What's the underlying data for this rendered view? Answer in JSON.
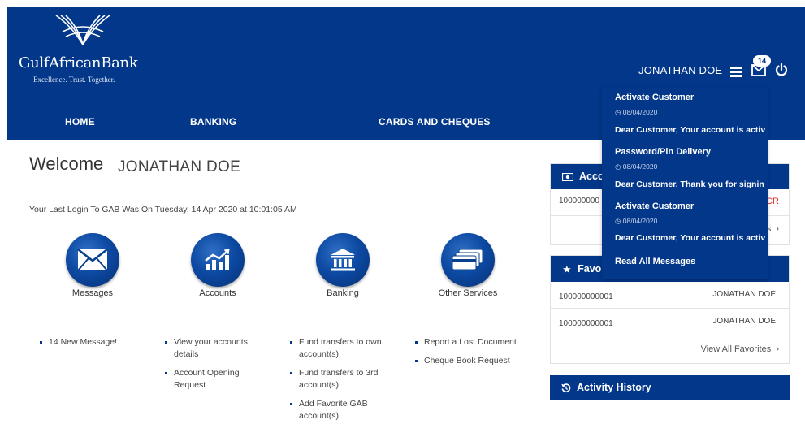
{
  "brand": {
    "name": "GulfAfricanBank",
    "tagline": "Excellence. Trust. Together."
  },
  "header": {
    "user_name": "JONATHAN DOE",
    "notification_count": "14"
  },
  "nav": [
    {
      "label": "HOME"
    },
    {
      "label": "BANKING"
    },
    {
      "label": "CARDS AND CHEQUES"
    }
  ],
  "welcome": {
    "greeting": "Welcome",
    "name": "JONATHAN DOE",
    "last_login": "Your Last Login To GAB Was On Tuesday, 14 Apr 2020 at 10:01:05 AM"
  },
  "services": [
    {
      "label": "Messages",
      "icon": "envelope-icon"
    },
    {
      "label": "Accounts",
      "icon": "chart-icon"
    },
    {
      "label": "Banking",
      "icon": "bank-icon"
    },
    {
      "label": "Other Services",
      "icon": "cards-icon"
    }
  ],
  "service_links": {
    "messages": [
      "14 New Message!"
    ],
    "accounts": [
      "View your accounts details",
      "Account Opening Request"
    ],
    "banking": [
      "Fund transfers to own account(s)",
      "Fund transfers to 3rd account(s)",
      "Add Favorite GAB account(s)"
    ],
    "other": [
      "Report a Lost Document",
      "Cheque Book Request"
    ]
  },
  "accounts_card": {
    "title": "Accou",
    "row_account": "100000000",
    "row_suffix": "CR",
    "view_all_fragment": "s"
  },
  "favorites_card": {
    "title": "Favori",
    "rows": [
      {
        "account": "100000000001",
        "name": "JONATHAN DOE"
      },
      {
        "account": "100000000001",
        "name": "JONATHAN DOE"
      }
    ],
    "view_all": "View All Favorites"
  },
  "activity_card": {
    "title": "Activity History"
  },
  "notifications": {
    "items": [
      {
        "title": "Activate Customer",
        "date": "08/04/2020",
        "body": "Dear Customer, Your account is activ"
      },
      {
        "title": "Password/Pin Delivery",
        "date": "08/04/2020",
        "body": "Dear Customer, Thank you for signin"
      },
      {
        "title": "Activate Customer",
        "date": "08/04/2020",
        "body": "Dear Customer, Your account is activ"
      }
    ],
    "read_all": "Read All Messages"
  },
  "colors": {
    "primary": "#03378a",
    "accent_red": "#e0302f"
  }
}
